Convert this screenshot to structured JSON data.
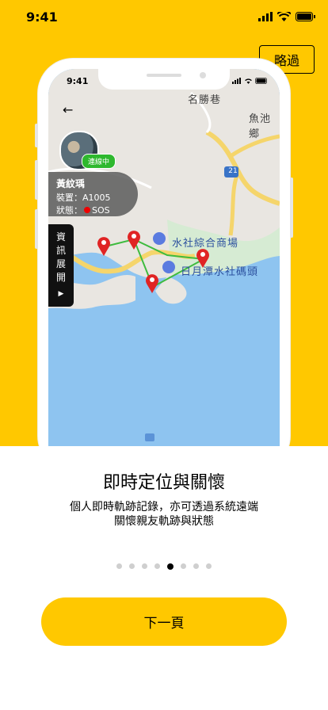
{
  "status_bar": {
    "time": "9:41"
  },
  "skip_label": "略過",
  "phone": {
    "time": "9:41",
    "map_labels": [
      "名勝巷",
      "魚池鄉",
      "水社綜合商場",
      "日月潭水社碼頭"
    ],
    "road_number": "21",
    "user": {
      "online": "連線中",
      "name": "黃紋瑀",
      "device": "裝置：A1005",
      "status_label": "狀態：",
      "status_value": "SOS"
    },
    "info_tab": [
      "資",
      "訊",
      "展",
      "開"
    ]
  },
  "onboarding": {
    "title": "即時定位與關懷",
    "desc_line1": "個人即時軌跡記錄，亦可透過系統遠端",
    "desc_line2": "關懷親友軌跡與狀態",
    "page_count": 8,
    "active_page": 5
  },
  "next_label": "下一頁",
  "colors": {
    "brand_yellow": "#FFC800",
    "online_green": "#2EB82E",
    "pin_red": "#E02424"
  }
}
